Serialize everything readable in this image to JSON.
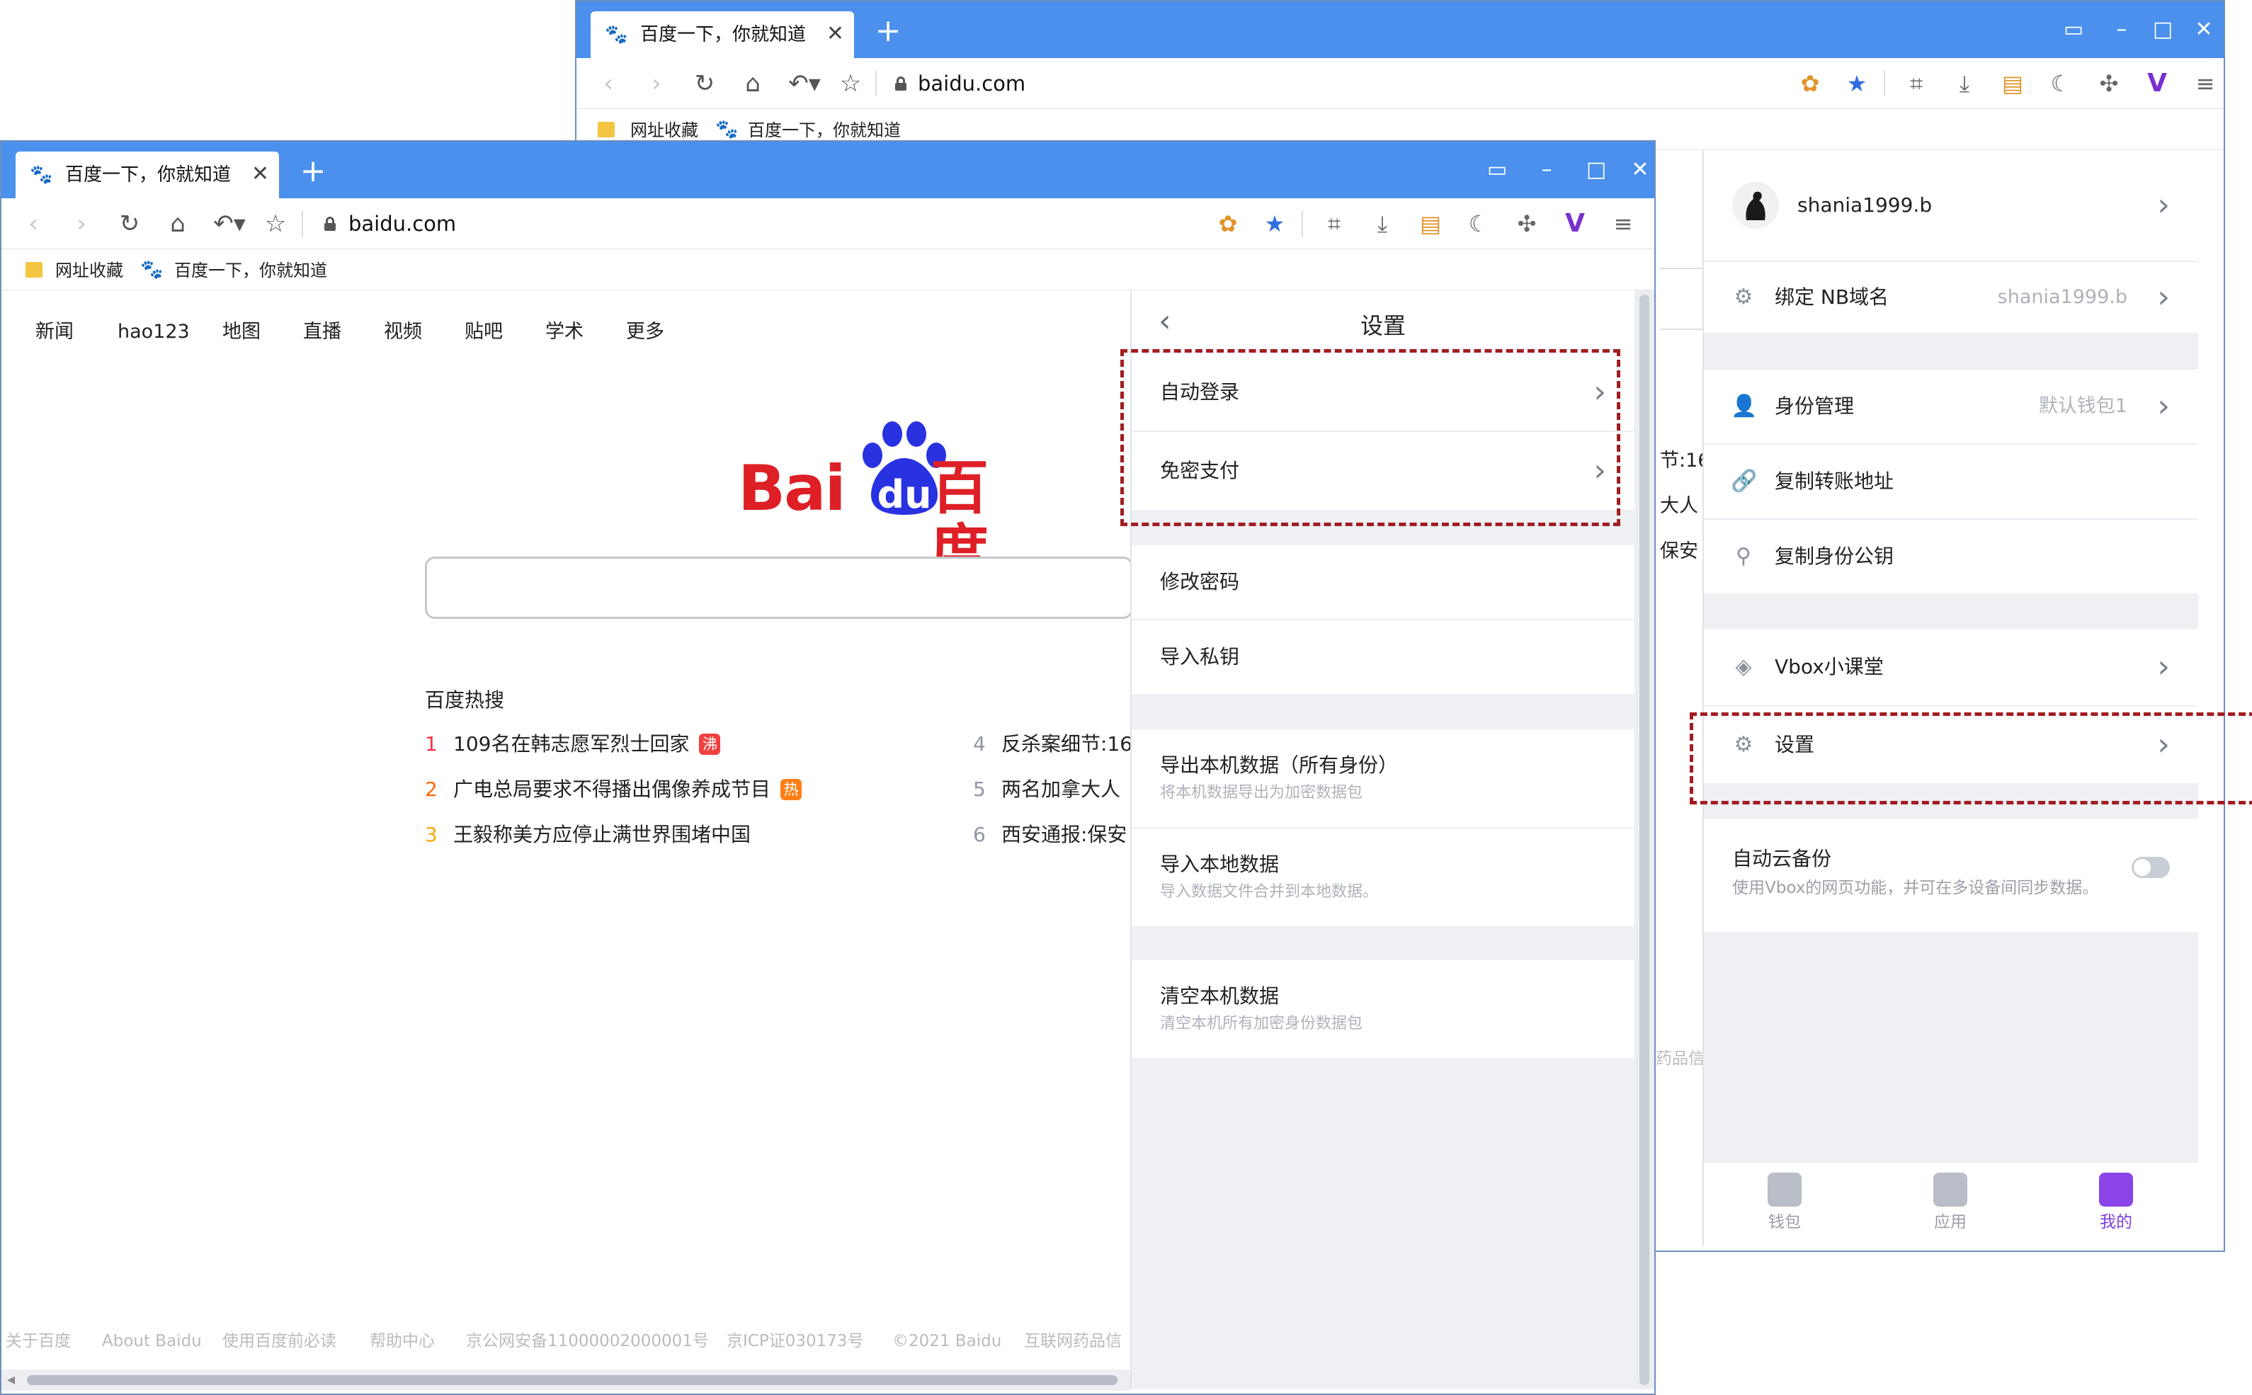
{
  "browser": {
    "tab_title": "百度一下，你就知道",
    "url": "baidu.com",
    "bookmarks": [
      "网址收藏",
      "百度一下，你就知道"
    ]
  },
  "baidu": {
    "nav": [
      "新闻",
      "hao123",
      "地图",
      "直播",
      "视频",
      "贴吧",
      "学术",
      "更多"
    ],
    "logo_text": "Bai",
    "logo_du": "du",
    "logo_cn": "百度",
    "hot_title": "百度热搜",
    "hot": [
      {
        "rank": "1",
        "text": "109名在韩志愿军烈士回家",
        "badge": "沸",
        "badge_color": "#f13f40"
      },
      {
        "rank": "2",
        "text": "广电总局要求不得播出偶像养成节目",
        "badge": "热",
        "badge_color": "#f60"
      },
      {
        "rank": "3",
        "text": "王毅称美方应停止满世界围堵中国",
        "badge": "",
        "badge_color": ""
      },
      {
        "rank": "4",
        "text": "反杀案细节:16",
        "badge": "",
        "badge_color": ""
      },
      {
        "rank": "5",
        "text": "两名加拿大人",
        "badge": "",
        "badge_color": ""
      },
      {
        "rank": "6",
        "text": "西安通报:保安",
        "badge": "",
        "badge_color": ""
      }
    ],
    "footer": [
      "关于百度",
      "About Baidu",
      "使用百度前必读",
      "帮助中心",
      "京公网安备11000002000001号",
      "京ICP证030173号",
      "©2021 Baidu",
      "互联网药品信"
    ]
  },
  "settings_panel": {
    "title": "设置",
    "items": [
      {
        "label": "自动登录",
        "sub": ""
      },
      {
        "label": "免密支付",
        "sub": ""
      },
      {
        "label": "修改密码",
        "sub": ""
      },
      {
        "label": "导入私钥",
        "sub": ""
      },
      {
        "label": "导出本机数据（所有身份）",
        "sub": "将本机数据导出为加密数据包"
      },
      {
        "label": "导入本地数据",
        "sub": "导入数据文件合并到本地数据。"
      },
      {
        "label": "清空本机数据",
        "sub": "清空本机所有加密身份数据包"
      }
    ]
  },
  "me_panel": {
    "username": "shania1999.b",
    "bind_label": "绑定 NB域名",
    "bind_value": "shania1999.b",
    "identity_label": "身份管理",
    "identity_value": "默认钱包1",
    "copy_address": "复制转账地址",
    "copy_pubkey": "复制身份公钥",
    "classroom": "Vbox小课堂",
    "settings": "设置",
    "cloud_backup": "自动云备份",
    "cloud_backup_desc": "使用Vbox的网页功能，并可在多设备间同步数据。",
    "tabs": [
      {
        "label": "钱包",
        "icon": "wallet-icon"
      },
      {
        "label": "应用",
        "icon": "apps-icon"
      },
      {
        "label": "我的",
        "icon": "profile-icon"
      }
    ]
  },
  "back_peek": [
    "节:16",
    "大人",
    "保安",
    "药品信"
  ],
  "colors": {
    "accent_blue": "#4a90ec",
    "baidu_red": "#de1f26",
    "baidu_blue": "#2932e1",
    "highlight": "#a11d22",
    "purple": "#7b3fe0"
  }
}
